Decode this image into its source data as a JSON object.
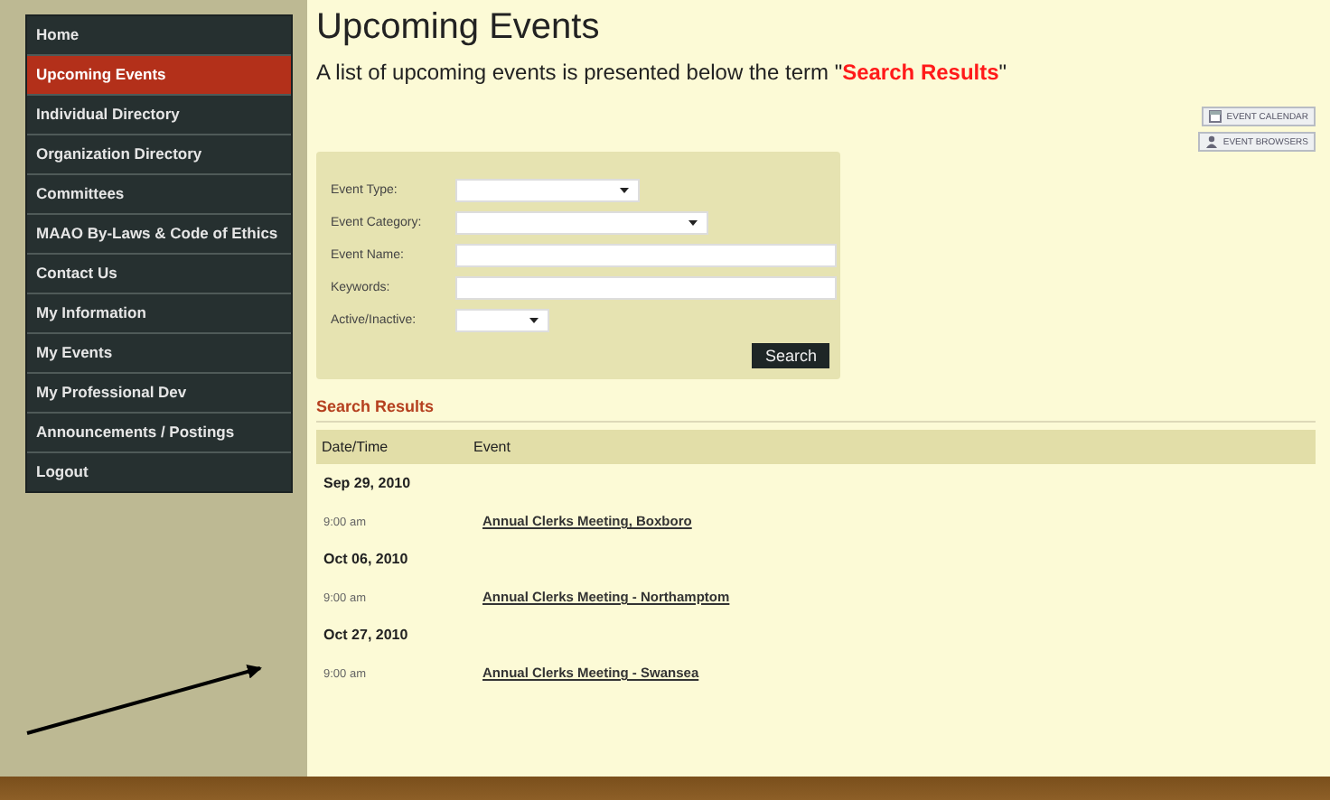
{
  "menu": [
    {
      "label": "Home",
      "selected": false
    },
    {
      "label": "Upcoming Events",
      "selected": true
    },
    {
      "label": "Individual Directory",
      "selected": false
    },
    {
      "label": "Organization Directory",
      "selected": false
    },
    {
      "label": "Committees",
      "selected": false
    },
    {
      "label": "MAAO By-Laws & Code of Ethics",
      "selected": false
    },
    {
      "label": "Contact Us",
      "selected": false
    },
    {
      "label": "My Information",
      "selected": false
    },
    {
      "label": "My Events",
      "selected": false
    },
    {
      "label": "My Professional Dev",
      "selected": false
    },
    {
      "label": "Announcements / Postings",
      "selected": false
    },
    {
      "label": "Logout",
      "selected": false
    }
  ],
  "title": "Upcoming Events",
  "intro": "A list of upcoming events is presented below the term \"**Search Results**\"",
  "side_buttons": [
    "EVENT CALENDAR",
    "EVENT BROWSERS"
  ],
  "form": {
    "fields": [
      {
        "label": "Event Type:",
        "kind": "select"
      },
      {
        "label": "Event Category:",
        "kind": "select"
      },
      {
        "label": "Event Name:",
        "kind": "text"
      },
      {
        "label": "Keywords:",
        "kind": "text"
      },
      {
        "label": "Active/Inactive:",
        "kind": "select"
      }
    ],
    "button": "Search"
  },
  "results": {
    "heading": "Search Results",
    "columns": [
      "Date/Time",
      "Event"
    ],
    "groups": [
      {
        "date": "Sep 29, 2010",
        "time": "9:00 am",
        "event": "Annual Clerks Meeting, Boxboro"
      },
      {
        "date": "Oct 06, 2010",
        "time": "9:00 am",
        "event": "Annual Clerks Meeting - Northamptom"
      },
      {
        "date": "Oct 27, 2010",
        "time": "9:00 am",
        "event": "Annual Clerks Meeting - Swansea"
      }
    ]
  }
}
